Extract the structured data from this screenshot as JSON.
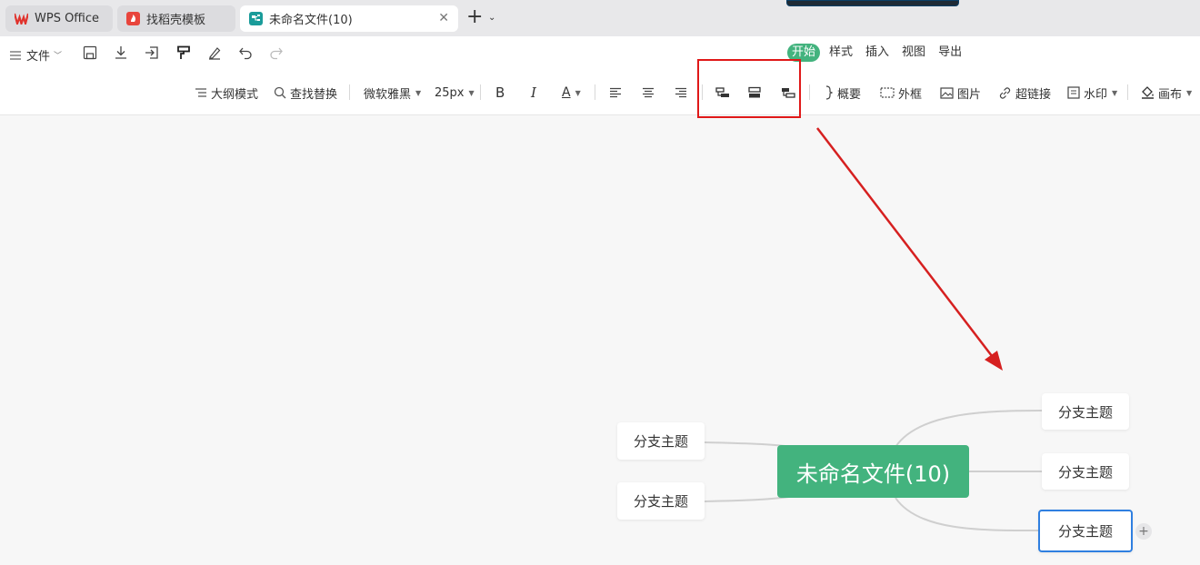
{
  "tabs": [
    {
      "label": "WPS Office"
    },
    {
      "label": "找稻壳模板"
    },
    {
      "label": "未命名文件(10)"
    }
  ],
  "file_menu": {
    "label": "文件"
  },
  "menu_tabs": [
    {
      "label": "开始",
      "active": true
    },
    {
      "label": "样式"
    },
    {
      "label": "插入"
    },
    {
      "label": "视图"
    },
    {
      "label": "导出"
    }
  ],
  "toolbar": {
    "outline": "大纲模式",
    "find_replace": "查找替换",
    "font": "微软雅黑",
    "size": "25px",
    "bold": "B",
    "italic": "I",
    "font_color": "A",
    "summary": "概要",
    "frame": "外框",
    "image": "图片",
    "hyperlink": "超链接",
    "watermark": "水印",
    "canvas": "画布"
  },
  "mindmap": {
    "root": "未命名文件(10)",
    "left_branches": [
      "分支主题",
      "分支主题"
    ],
    "right_branches": [
      "分支主题",
      "分支主题",
      "分支主题"
    ]
  },
  "colors": {
    "accent": "#43b37e",
    "highlight": "#e01818",
    "selected": "#2f7fe0"
  }
}
